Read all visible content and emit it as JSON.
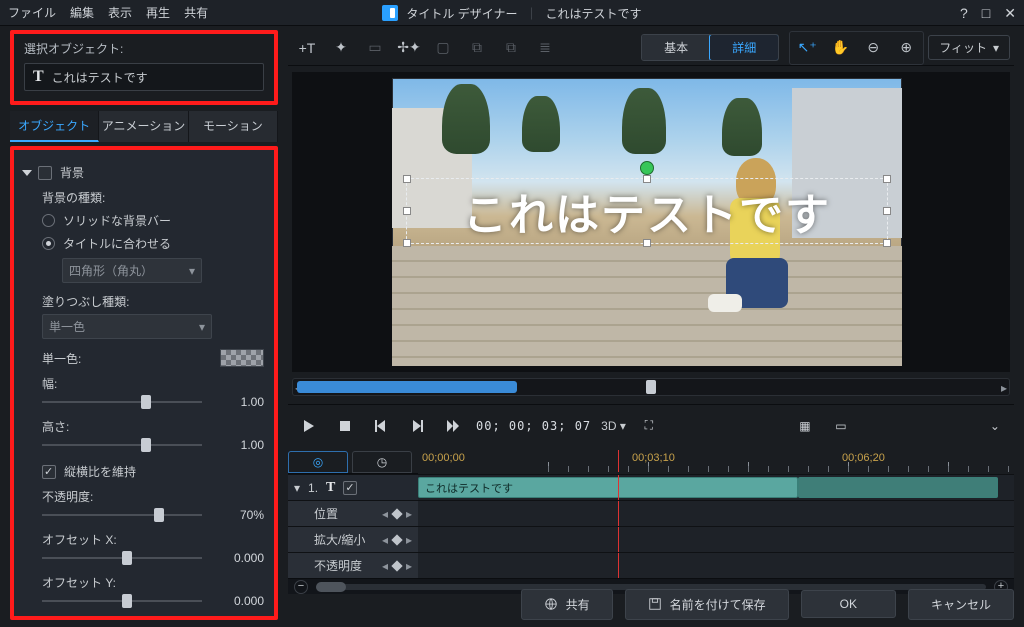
{
  "menu": {
    "file": "ファイル",
    "edit": "編集",
    "view": "表示",
    "play": "再生",
    "share": "共有"
  },
  "app": {
    "title": "タイトル デザイナー",
    "doc": "これはテストです"
  },
  "sel_label": "選択オブジェクト:",
  "sel_value": "これはテストです",
  "ltabs": {
    "object": "オブジェクト",
    "animation": "アニメーション",
    "motion": "モーション"
  },
  "bg": {
    "section": "背景",
    "type_label": "背景の種類:",
    "solid_bar": "ソリッドな背景バー",
    "fit_title": "タイトルに合わせる",
    "shape_sel": "四角形（角丸）",
    "fill_label": "塗りつぶし種類:",
    "fill_sel": "単一色",
    "color_label": "単一色:",
    "width_label": "幅:",
    "width_val": "1.00",
    "height_label": "高さ:",
    "height_val": "1.00",
    "keep_ratio": "縦横比を維持",
    "opacity_label": "不透明度:",
    "opacity_val": "70%",
    "offx_label": "オフセット X:",
    "offx_val": "0.000",
    "offy_label": "オフセット Y:",
    "offy_val": "0.000"
  },
  "view_tabs": {
    "basic": "基本",
    "advanced": "詳細"
  },
  "fit": "フィット",
  "preview_text": "これはテストです",
  "play": {
    "tc": "00; 00; 03; 07",
    "threeD": "3D"
  },
  "ruler": {
    "t0": "00;00;00",
    "t1": "00;03;10",
    "t2": "00;06;20"
  },
  "track": {
    "num": "1.",
    "clip_label": "これはテストです",
    "pos": "位置",
    "scale": "拡大/縮小",
    "opacity": "不透明度"
  },
  "footer": {
    "share": "共有",
    "saveas": "名前を付けて保存",
    "ok": "OK",
    "cancel": "キャンセル"
  }
}
